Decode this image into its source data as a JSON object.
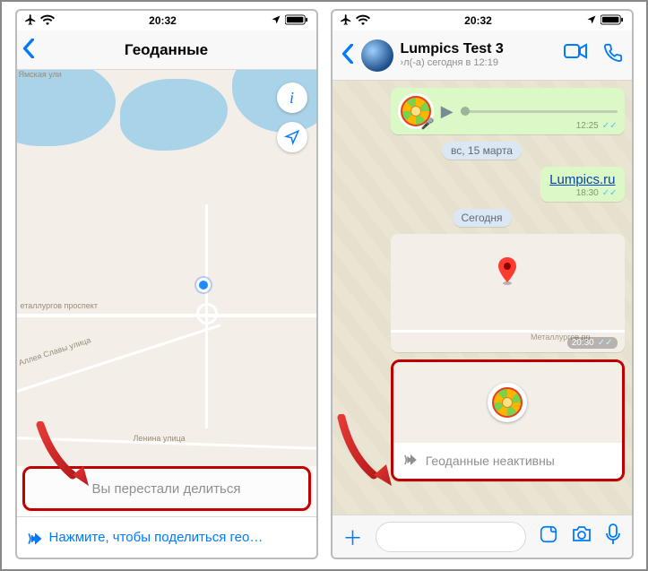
{
  "status": {
    "time": "20:32"
  },
  "left": {
    "nav_title": "Геоданные",
    "streets": {
      "yamskaya": "Ямская ули",
      "metallurgov": "еталлургов проспект",
      "alley": "Аллея Славы улица",
      "lenina": "Ленина улица"
    },
    "stopped_text": "Вы перестали делиться",
    "share_cta": "Нажмите, чтобы поделиться гео…"
  },
  "right": {
    "chat_name": "Lumpics Test 3",
    "chat_sub": "›л(-а) сегодня в 12:19",
    "dates": {
      "march15": "вс, 15 марта",
      "today": "Сегодня"
    },
    "voice": {
      "time": "12:25"
    },
    "link": {
      "text": "Lumpics.ru",
      "time": "18:30"
    },
    "loc_msg": {
      "time": "20:30",
      "street": "Металлургов пр"
    },
    "live": {
      "label": "Геоданные неактивны"
    }
  }
}
